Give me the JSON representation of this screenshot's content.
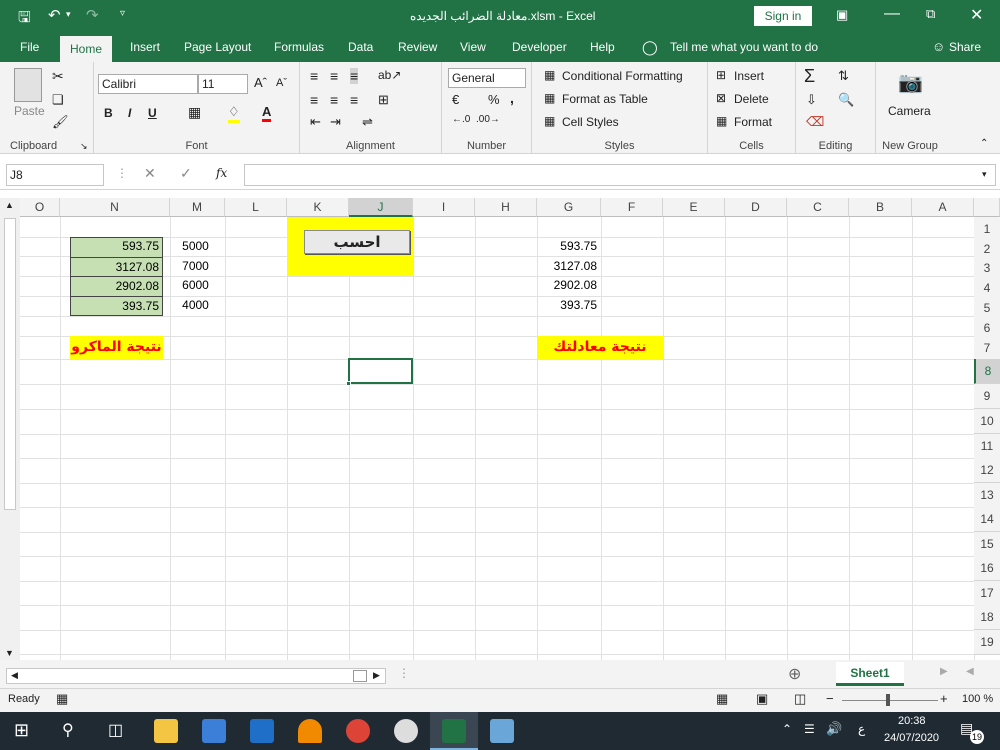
{
  "titlebar": {
    "title": "معادلة الضرائب الجديده.xlsm  -  Excel",
    "sign_in": "Sign in"
  },
  "tabs": [
    "File",
    "Home",
    "Insert",
    "Page Layout",
    "Formulas",
    "Data",
    "Review",
    "View",
    "Developer",
    "Help"
  ],
  "tell_me": "Tell me what you want to do",
  "share": "Share",
  "ribbon": {
    "clipboard": {
      "label": "Clipboard",
      "paste": "Paste"
    },
    "font": {
      "label": "Font",
      "name": "Calibri",
      "size": "11",
      "bold": "B",
      "italic": "I",
      "underline": "U"
    },
    "alignment": {
      "label": "Alignment"
    },
    "number": {
      "label": "Number",
      "format": "General",
      "percent": "%",
      "comma": ","
    },
    "styles": {
      "label": "Styles",
      "conditional": "Conditional Formatting",
      "format_table": "Format as Table",
      "cell_styles": "Cell Styles"
    },
    "cells": {
      "label": "Cells",
      "insert": "Insert",
      "delete": "Delete",
      "format": "Format"
    },
    "editing": {
      "label": "Editing"
    },
    "newgroup": {
      "label": "New Group",
      "camera": "Camera"
    }
  },
  "formula_bar": {
    "name_box": "J8",
    "fx": "fx",
    "value": ""
  },
  "columns": [
    "O",
    "N",
    "M",
    "L",
    "K",
    "J",
    "I",
    "H",
    "G",
    "F",
    "E",
    "D",
    "C",
    "B",
    "A"
  ],
  "rows": [
    "1",
    "2",
    "3",
    "4",
    "5",
    "6",
    "7",
    "8",
    "9",
    "10",
    "11",
    "12",
    "13",
    "14",
    "15",
    "16",
    "17",
    "18",
    "19"
  ],
  "sheet": {
    "n_values": [
      "593.75",
      "3127.08",
      "2902.08",
      "393.75"
    ],
    "m_values": [
      "5000",
      "7000",
      "6000",
      "4000"
    ],
    "g_values": [
      "593.75",
      "3127.08",
      "2902.08",
      "393.75"
    ],
    "macro_label": "نتيجة الماكرو",
    "formula_label": "نتيجة معادلتك",
    "calc_button": "احسب",
    "colors": {
      "green_fill": "#c6e0b4",
      "yellow_fill": "#ffff00",
      "label_red": "#ff0000"
    }
  },
  "sheet_tab": "Sheet1",
  "status": {
    "ready": "Ready",
    "zoom": "100 %"
  },
  "taskbar": {
    "lang": "ع",
    "time": "20:38",
    "date": "24/07/2020",
    "notifications": "19"
  }
}
